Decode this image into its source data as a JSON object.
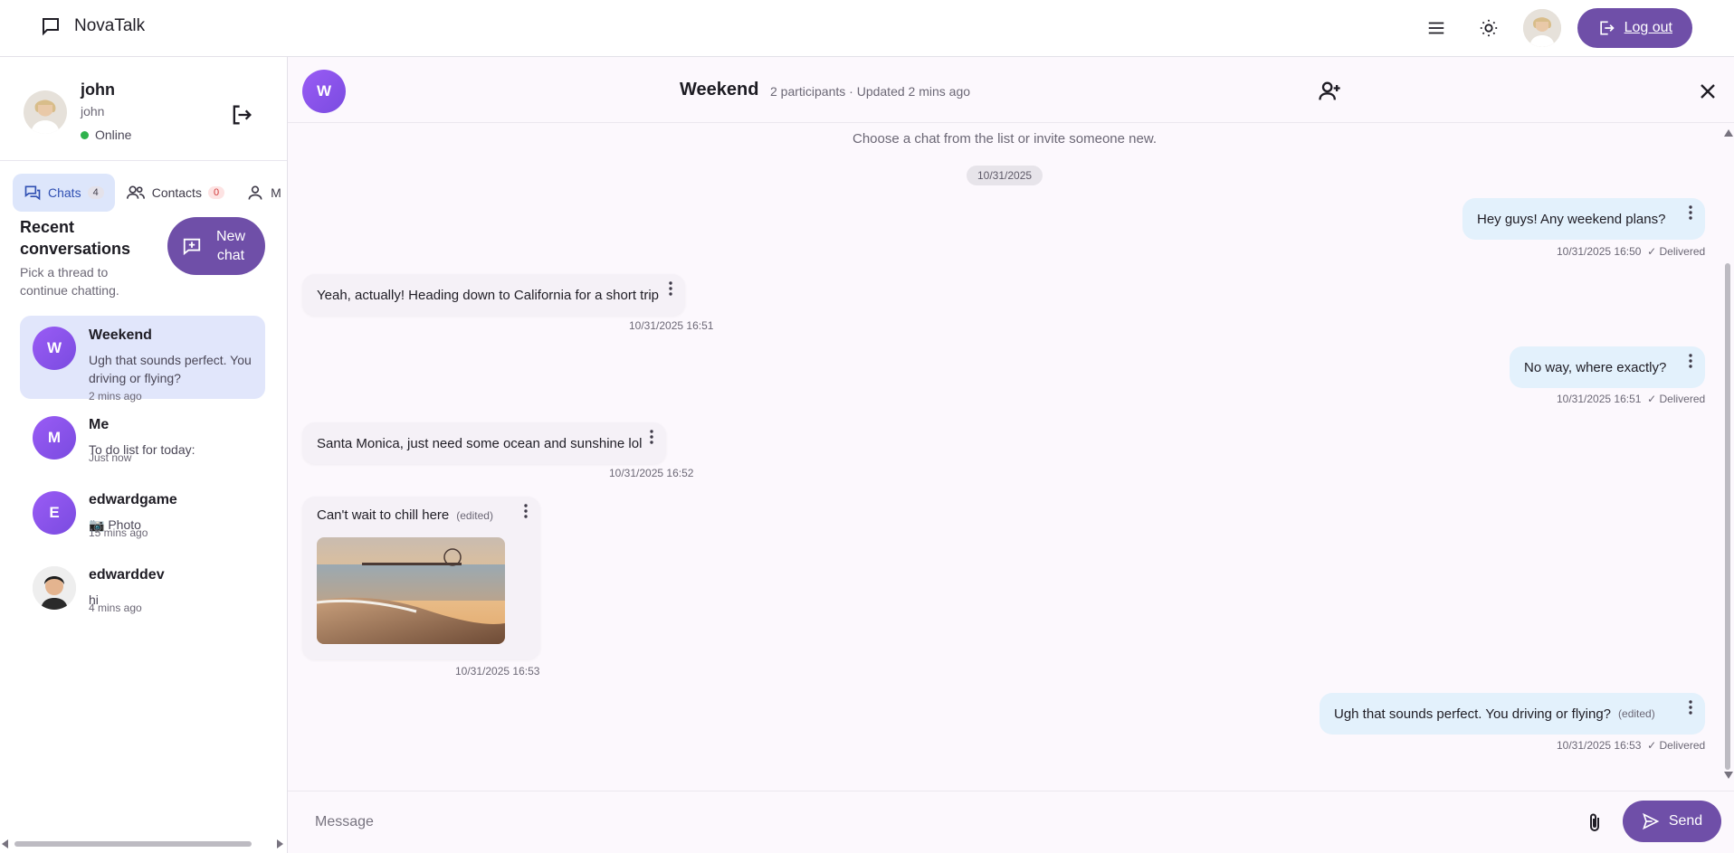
{
  "app": {
    "title": "NovaTalk",
    "logout_label": "Log out"
  },
  "sidebar": {
    "profile": {
      "name": "john",
      "username": "john",
      "status": "Online"
    },
    "tabs": [
      {
        "label": "Chats",
        "count": "4"
      },
      {
        "label": "Contacts",
        "count": "0"
      },
      {
        "label": "M"
      }
    ],
    "recent_title": "Recent conversations",
    "recent_subtitle": "Pick a thread to continue chatting.",
    "new_chat_label": "New chat",
    "conversations": [
      {
        "initial": "W",
        "name": "Weekend",
        "preview": "Ugh that sounds perfect. You driving or flying?",
        "time": "2 mins ago"
      },
      {
        "initial": "M",
        "name": "Me",
        "preview": "To do list for today:",
        "time": "Just now"
      },
      {
        "initial": "E",
        "name": "edwardgame",
        "preview": "📷 Photo",
        "time": "15 mins ago"
      },
      {
        "initial": "",
        "name": "edwarddev",
        "preview": "hi",
        "time": "4 mins ago"
      }
    ]
  },
  "chat": {
    "initial": "W",
    "title": "Weekend",
    "subtitle": "2 participants · Updated 2 mins ago",
    "hint": "Choose a chat from the list or invite someone new.",
    "date": "10/31/2025",
    "messages": [
      {
        "dir": "out",
        "text": "Hey guys! Any weekend plans?",
        "time": "10/31/2025 16:50",
        "status": "✓ Delivered"
      },
      {
        "dir": "in",
        "text": "Yeah, actually! Heading down to California for a short trip",
        "time": "10/31/2025 16:51"
      },
      {
        "dir": "out",
        "text": "No way, where exactly?",
        "time": "10/31/2025 16:51",
        "status": "✓ Delivered"
      },
      {
        "dir": "in",
        "text": "Santa Monica, just need some ocean and sunshine lol",
        "time": "10/31/2025 16:52"
      },
      {
        "dir": "in",
        "text": "Can't wait to chill here",
        "edited": "(edited)",
        "time": "10/31/2025 16:53",
        "image": "beach-pier-photo"
      },
      {
        "dir": "out",
        "text": "Ugh that sounds perfect. You driving or flying?",
        "edited": "(edited)",
        "time": "10/31/2025 16:53",
        "status": "✓ Delivered"
      }
    ],
    "composer": {
      "placeholder": "Message",
      "send_label": "Send"
    }
  },
  "colors": {
    "accent": "#6f4fa8",
    "outgoing_bubble": "#e3f1fc",
    "active_item": "#e1e6fb",
    "online": "#2fb24c"
  }
}
